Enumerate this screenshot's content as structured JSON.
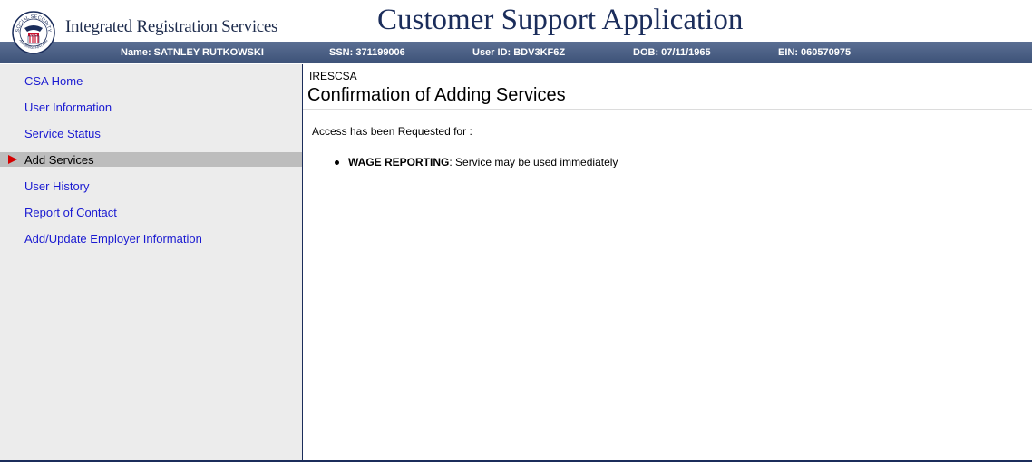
{
  "header": {
    "org_title": "Integrated Registration Services",
    "app_title": "Customer Support Application",
    "seal": {
      "icon": "ssa-seal-icon",
      "top_text": "SOCIAL SECURITY",
      "bottom_text": "ADMINISTRATION",
      "center_text": "USA"
    }
  },
  "info_bar": {
    "name": "Name: SATNLEY RUTKOWSKI",
    "ssn": "SSN: 371199006",
    "user_id": "User ID: BDV3KF6Z",
    "dob": "DOB: 07/11/1965",
    "ein": "EIN: 060570975"
  },
  "sidebar": {
    "items": [
      {
        "label": "CSA Home",
        "active": false
      },
      {
        "label": "User Information",
        "active": false
      },
      {
        "label": "Service Status",
        "active": false
      },
      {
        "label": "Add Services",
        "active": true,
        "icon": "current-page-arrow-icon"
      },
      {
        "label": "User History",
        "active": false
      },
      {
        "label": "Report of Contact",
        "active": false
      },
      {
        "label": "Add/Update Employer Information",
        "active": false
      }
    ]
  },
  "main": {
    "page_code": "IRESCSA",
    "heading": "Confirmation of Adding Services",
    "access_text": "Access has been Requested for :",
    "services": [
      {
        "name": "WAGE REPORTING",
        "status": ": Service may be used immediately"
      }
    ]
  },
  "colors": {
    "header_bar": "#4a5f85",
    "title_navy": "#1b2d5b",
    "link_blue": "#1a1ad1",
    "sidebar_bg": "#ececec",
    "active_bg": "#bdbdbd",
    "arrow_red": "#d40000"
  }
}
